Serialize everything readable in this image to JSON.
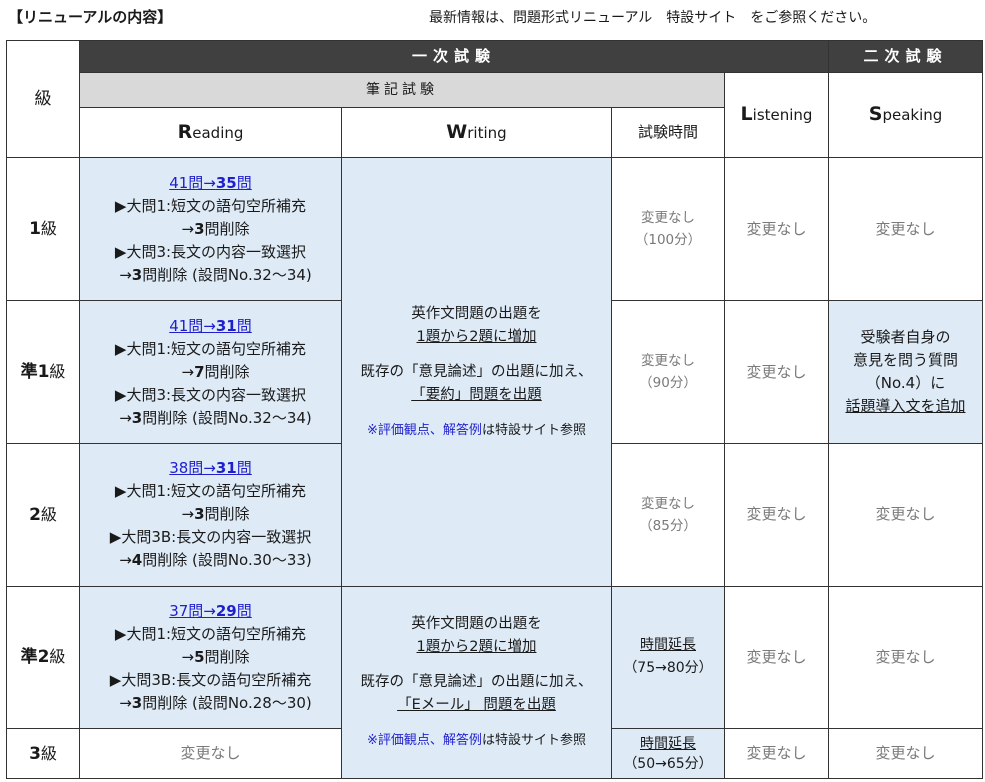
{
  "header": {
    "title": "【リニューアルの内容】",
    "note": "最新情報は、問題形式リニューアル　特設サイト　をご参照ください。"
  },
  "table_head": {
    "grade": "級",
    "first_exam": "一次試験",
    "second_exam": "二次試験",
    "written_exam": "筆記試験",
    "reading_initial": "R",
    "reading_rest": "eading",
    "writing_initial": "W",
    "writing_rest": "riting",
    "exam_time": "試験時間",
    "listening_initial": "L",
    "listening_rest": "istening",
    "speaking_initial": "S",
    "speaking_rest": "peaking"
  },
  "rows": [
    {
      "grade_prefix": "",
      "grade_num": "1",
      "grade_suffix": "級",
      "reading": {
        "link_from": "41問→",
        "link_to_num": "35",
        "link_to_unit": "問",
        "l1": "▶大問1:短文の語句空所補充",
        "l2_arrow": "→",
        "l2_num": "3",
        "l2_rest": "問削除",
        "l3": "▶大問3:長文の内容一致選択",
        "l4_arrow": "→",
        "l4_num": "3",
        "l4_rest": "問削除 (設問No.32～34)"
      },
      "time_main": "変更なし",
      "time_sub": "（100分）",
      "listening": "変更なし",
      "speaking": "変更なし"
    },
    {
      "grade_prefix": "準",
      "grade_num": "1",
      "grade_suffix": "級",
      "reading": {
        "link_from": "41問→",
        "link_to_num": "31",
        "link_to_unit": "問",
        "l1": "▶大問1:短文の語句空所補充",
        "l2_arrow": "→",
        "l2_num": "7",
        "l2_rest": "問削除",
        "l3": "▶大問3:長文の内容一致選択",
        "l4_arrow": "→",
        "l4_num": "3",
        "l4_rest": "問削除 (設問No.32～34)"
      },
      "time_main": "変更なし",
      "time_sub": "（90分）",
      "listening": "変更なし",
      "speaking": {
        "l1": "受験者自身の",
        "l2": "意見を問う質問",
        "l3": "（No.4）に",
        "l4": "話題導入文を追加"
      }
    },
    {
      "grade_prefix": "",
      "grade_num": "2",
      "grade_suffix": "級",
      "reading": {
        "link_from": "38問→",
        "link_to_num": "31",
        "link_to_unit": "問",
        "l1": "▶大問1:短文の語句空所補充",
        "l2_arrow": "→",
        "l2_num": "3",
        "l2_rest": "問削除",
        "l3": "▶大問3B:長文の内容一致選択",
        "l4_arrow": "→",
        "l4_num": "4",
        "l4_rest": "問削除 (設問No.30～33)"
      },
      "time_main": "変更なし",
      "time_sub": "（85分）",
      "listening": "変更なし",
      "speaking": "変更なし"
    },
    {
      "grade_prefix": "準",
      "grade_num": "2",
      "grade_suffix": "級",
      "reading": {
        "link_from": "37問→",
        "link_to_num": "29",
        "link_to_unit": "問",
        "l1": "▶大問1:短文の語句空所補充",
        "l2_arrow": "→",
        "l2_num": "5",
        "l2_rest": "問削除",
        "l3": "▶大問3B:長文の語句空所補充",
        "l4_arrow": "→",
        "l4_num": "3",
        "l4_rest": "問削除 (設問No.28～30)"
      },
      "time_main": "時間延長",
      "time_sub": "（75→80分）",
      "listening": "変更なし",
      "speaking": "変更なし"
    },
    {
      "grade_prefix": "",
      "grade_num": "3",
      "grade_suffix": "級",
      "reading_plain": "変更なし",
      "time_main": "時間延長",
      "time_sub": "（50→65分）",
      "listening": "変更なし",
      "speaking": "変更なし"
    }
  ],
  "writing_upper": {
    "l1": "英作文問題の出題を",
    "l2": "1題から2題に増加",
    "l3": "既存の「意見論述」の出題に加え、",
    "l4": "「要約」問題を出題",
    "note_blue": "※評価観点、解答例",
    "note_black": "は特設サイト参照"
  },
  "writing_lower": {
    "l1": "英作文問題の出題を",
    "l2": "1題から2題に増加",
    "l3": "既存の「意見論述」の出題に加え、",
    "l4": "「Eメール」 問題を出題",
    "note_blue": "※評価観点、解答例",
    "note_black": "は特設サイト参照"
  },
  "colors": {
    "dark_band": "#404040",
    "grey_band": "#d9d9d9",
    "light_blue": "#deebf7",
    "link_blue": "#1f1fcc",
    "muted_gray": "#7a7a7a"
  }
}
